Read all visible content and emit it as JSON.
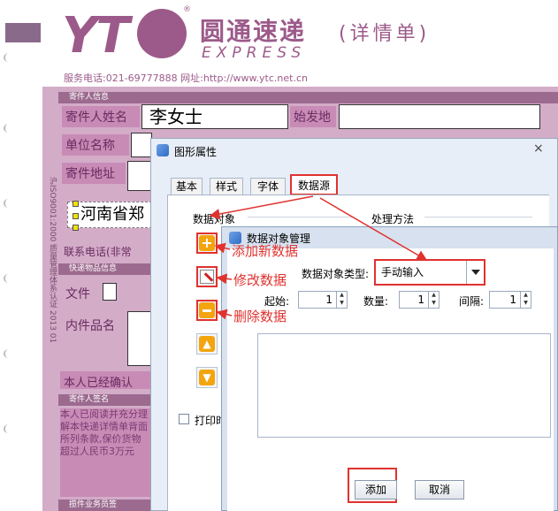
{
  "waybill": {
    "logo_letters": "YT",
    "brand_cn": "圆通速递",
    "brand_en": "EXPRESS",
    "doc_type": "(详情单)",
    "phone_line": "服务电话:021-69777888  网址:http://www.ytc.net.cn",
    "sender_section": "寄件人信息",
    "sender_name_label": "寄件人姓名",
    "sender_name_value": "李女士",
    "origin_label": "始发地",
    "company_label": "单位名称",
    "address_label": "寄件地址",
    "address_value": "河南省郑",
    "phone_label": "联系电话(非常",
    "item_section": "快递物品信息",
    "doc_label": "文件",
    "contents_label": "内件品名",
    "confirm_label": "本人已经确认",
    "sign_section": "寄件人签名",
    "sign_text": "本人已阅读并充分理解本快递详情单背面所列条款,保价货物超过人民币3万元",
    "bottom_section": "揽件业务员签",
    "side_text": "沪ISO9001:2000 质量管理体系认证  2013 01"
  },
  "dialog_props": {
    "title": "图形属性",
    "close": "×",
    "tabs": [
      "基本",
      "样式",
      "字体",
      "数据源"
    ],
    "active_tab": "数据源",
    "data_object_label": "数据对象",
    "process_label": "处理方法",
    "print_label": "打印时"
  },
  "dialog_data": {
    "title": "数据对象管理",
    "type_label": "数据对象类型:",
    "type_value": "手动输入",
    "start_label": "起始:",
    "start_value": "1",
    "count_label": "数量:",
    "count_value": "1",
    "interval_label": "间隔:",
    "interval_value": "1",
    "add_button": "添加",
    "cancel_button": "取消"
  },
  "annotations": {
    "add": "添加新数据",
    "edit": "修改数据",
    "delete": "删除数据"
  },
  "colors": {
    "brand": "#9c5a8a",
    "form_bg": "#d3acc8",
    "annotation": "#e0322f"
  }
}
